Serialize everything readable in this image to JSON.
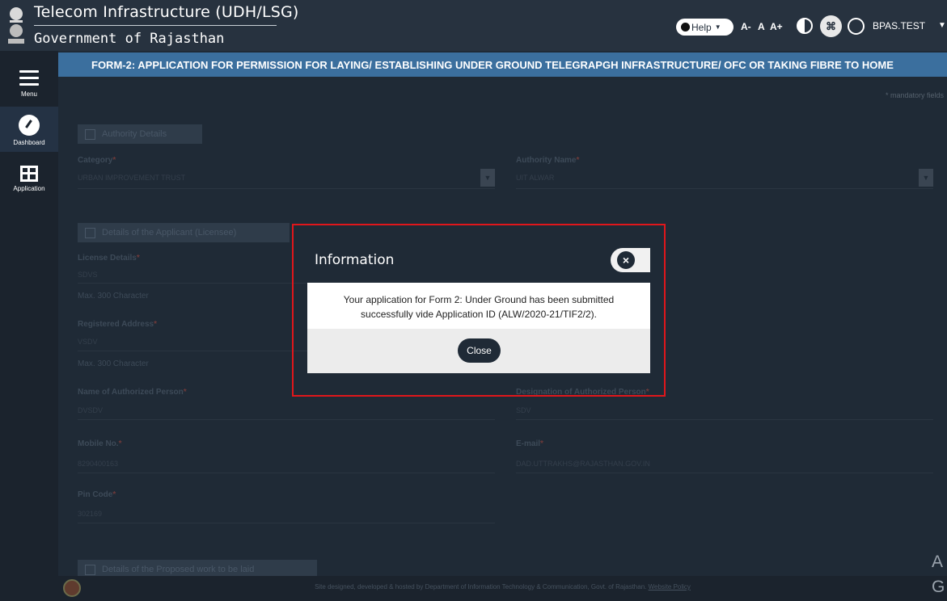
{
  "header": {
    "title": "Telecom Infrastructure (UDH/LSG)",
    "subtitle": "Government of Rajasthan",
    "help_label": "Help",
    "font_small": "A-",
    "font_normal": "A",
    "font_large": "A+",
    "user_name": "BPAS.TEST"
  },
  "sidebar": {
    "items": [
      {
        "label": "Menu",
        "icon": "hamburger-icon"
      },
      {
        "label": "Dashboard",
        "icon": "dashboard-icon"
      },
      {
        "label": "Application",
        "icon": "grid-icon"
      }
    ]
  },
  "main": {
    "form_title": "FORM-2: APPLICATION FOR PERMISSION FOR LAYING/ ESTABLISHING UNDER GROUND TELEGRAPGH INFRASTRUCTURE/ OFC OR TAKING FIBRE TO HOME",
    "mandatory_note": "* mandatory fields",
    "authority_section": {
      "heading": "Authority Details",
      "category_label": "Category",
      "category_value": "URBAN IMPROVEMENT TRUST",
      "authority_label": "Authority Name",
      "authority_value": "UIT ALWAR"
    },
    "applicant_section": {
      "heading": "Details of the Applicant (Licensee)",
      "license_label": "License Details",
      "license_value": "SDVS",
      "max_char_1": "Max. 300 Character",
      "address_label": "Registered Address",
      "address_value": "VSDV",
      "max_char_2": "Max. 300 Character",
      "auth_person_label": "Name of Authorized Person",
      "auth_person_value": "DVSDV",
      "designation_label": "Designation of Authorized Person",
      "designation_value": "SDV",
      "mobile_label": "Mobile No.",
      "mobile_value": "8290400163",
      "email_label": "E-mail",
      "email_value": "DAD.UTTRAKHS@RAJASTHAN.GOV.IN",
      "pincode_label": "Pin Code",
      "pincode_value": "302169"
    },
    "work_section": {
      "heading": "Details of the Proposed work to be laid"
    }
  },
  "footer": {
    "text": "Site designed, developed & hosted by Department of Information Technology & Communication, Govt. of Rajasthan.",
    "link": "Website Policy"
  },
  "corner": {
    "line1": "A",
    "line2": "G"
  },
  "modal": {
    "title": "Information",
    "message_line1": "Your application for Form 2: Under Ground has been submitted",
    "message_line2": "successfully vide Application ID (ALW/2020-21/TIF2/2).",
    "close_label": "Close"
  }
}
